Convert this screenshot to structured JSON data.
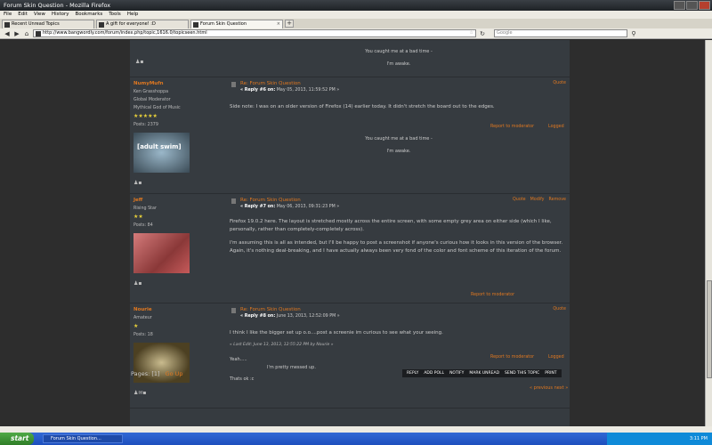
{
  "window": {
    "title": "Forum Skin Question - Mozilla Firefox"
  },
  "menu": [
    "File",
    "Edit",
    "View",
    "History",
    "Bookmarks",
    "Tools",
    "Help"
  ],
  "tabs": [
    {
      "label": "Recent Unread Topics"
    },
    {
      "label": "A gift for everyone! :D"
    },
    {
      "label": "Forum Skin Question"
    }
  ],
  "nav": {
    "url": "http://www.bangwordly.com/forum/index.php/topic,1616.0/topicseen.html",
    "search_placeholder": "Google"
  },
  "posts": [
    {
      "sig_lines": [
        "You caught me at a bad time -",
        "I'm awake."
      ]
    },
    {
      "username": "NumyMufn",
      "title_line": "Ken Grasshoppa",
      "rank": "Global Moderator",
      "rank2": "Mythical God of Music",
      "stars": "★★★★★",
      "posts": "Posts: 2379",
      "avatar_text": "[adult swim]",
      "subject": "Re: Forum Skin Question",
      "reply": "« Reply #6 on:",
      "date": "May 05, 2013, 11:59:52 PM »",
      "actions": [
        "Quote"
      ],
      "text": "Side note: I was on an older version of Firefox (14) earlier today. It didn't stretch the board out to the edges.",
      "report": "Report to moderator",
      "logged": "Logged",
      "sig_lines": [
        "You caught me at a bad time -",
        "I'm awake."
      ]
    },
    {
      "username": "Jeff",
      "rank": "Rising Star",
      "stars": "★★",
      "posts": "Posts: 84",
      "subject": "Re: Forum Skin Question",
      "reply": "« Reply #7 on:",
      "date": "May 06, 2013, 09:31:23 PM »",
      "actions": [
        "Quote",
        "Modify",
        "Remove"
      ],
      "para1": "Firefox 19.0.2 here.  The layout is stretched mostly across the entire screen, with some empty grey area on either side (which I like, personally, rather than completely-completely across).",
      "para2": "I'm assuming this is all as intended, but I'll be happy to post a screenshot if anyone's curious how it looks in this version of the browser.  Again, it's nothing deal-breaking, and I have actually always been very fond of the color and font scheme of this iteration of the forum.",
      "report": "Report to moderator"
    },
    {
      "username": "Nourie",
      "rank": "Amateur",
      "stars": "★",
      "posts": "Posts: 18",
      "subject": "Re: Forum Skin Question",
      "reply": "« Reply #8 on:",
      "date": "June 13, 2013, 12:52:09 PM »",
      "actions": [
        "Quote"
      ],
      "text": "I think I like the bigger set up o.o....post a screenie im curious to see what your seeing.",
      "last_edit": "« Last Edit: June 13, 2013, 12:55:22 PM by Nourie »",
      "report": "Report to moderator",
      "logged": "Logged",
      "sig1": "Yeah.....",
      "sig2": "I'm pretty messed up.",
      "sig3": "Thats ok :c"
    }
  ],
  "pagination": {
    "pages": "Pages: [1]",
    "go_up": "Go Up"
  },
  "topic_buttons": [
    "REPLY",
    "ADD POLL",
    "NOTIFY",
    "MARK UNREAD",
    "SEND THIS TOPIC",
    "PRINT"
  ],
  "prevnext": "« previous next »",
  "taskbar": {
    "start": "start",
    "window_button": "Forum Skin Question...",
    "clock": "3:11 PM"
  }
}
